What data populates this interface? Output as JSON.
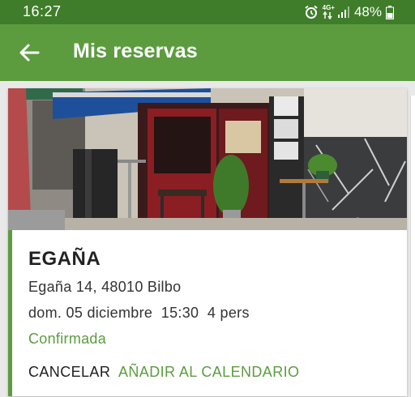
{
  "status_bar": {
    "time": "16:27",
    "network": "4G+",
    "battery": "48%",
    "icons": [
      "alarm-icon",
      "network-arrows-icon",
      "signal-icon",
      "battery-icon"
    ]
  },
  "app_bar": {
    "back_icon": "arrow-left-icon",
    "title": "Mis reservas"
  },
  "reservation": {
    "name": "EGAÑA",
    "address": "Egaña 14, 48010 Bilbo",
    "datetime": "dom. 05 diciembre  15:30  4 pers",
    "status": "Confirmada",
    "actions": {
      "cancel": "CANCELAR",
      "add_calendar": "AÑADIR AL CALENDARIO"
    }
  },
  "colors": {
    "status_bar": "#3f7d2a",
    "app_bar": "#5c9c3f",
    "accent": "#5c9c3f",
    "text_primary": "#222222"
  }
}
